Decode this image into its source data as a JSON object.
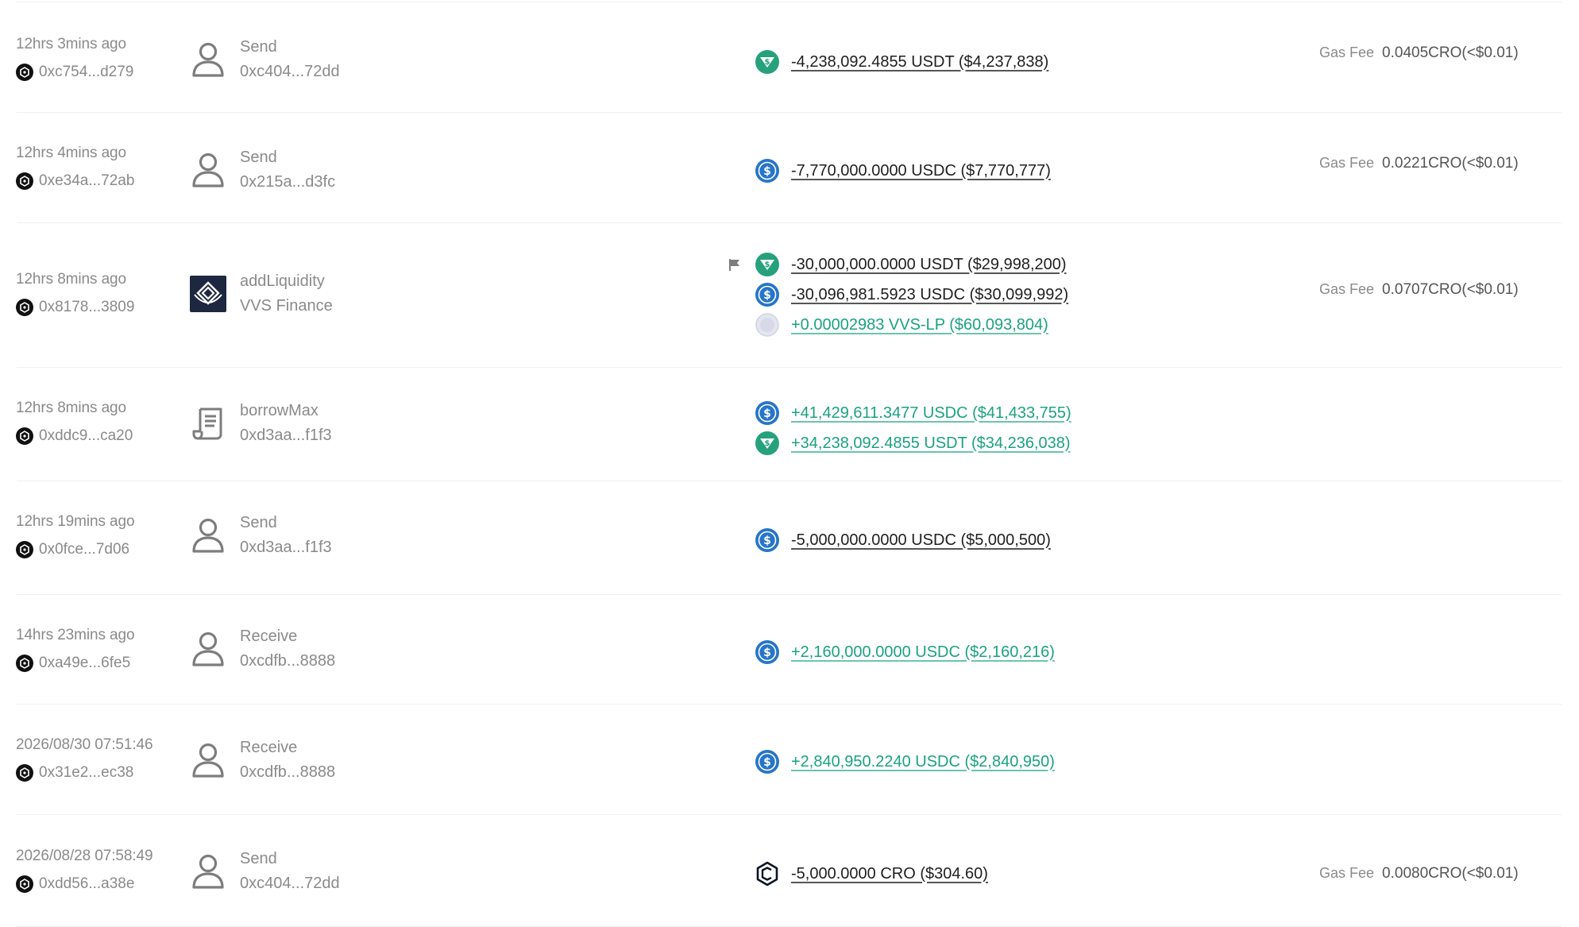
{
  "colors": {
    "positive": "#1aa283",
    "negative": "#1f1f1f",
    "muted": "#8a8a8a",
    "usdt": "#26a17b",
    "usdc": "#2775ca",
    "cro": "#0b1426"
  },
  "transactions": [
    {
      "time": "12hrs 3mins ago",
      "hash": "0xc754...d279",
      "action": "Send",
      "action_icon": "user-icon",
      "target": "0xc404...72dd",
      "flagged": false,
      "amounts": [
        {
          "text": "-4,238,092.4855 USDT ($4,237,838)",
          "token": "usdt",
          "sign": "neg"
        }
      ],
      "gas_label": "Gas Fee",
      "gas_value": "0.0405CRO(<$0.01)"
    },
    {
      "time": "12hrs 4mins ago",
      "hash": "0xe34a...72ab",
      "action": "Send",
      "action_icon": "user-icon",
      "target": "0x215a...d3fc",
      "flagged": false,
      "amounts": [
        {
          "text": "-7,770,000.0000 USDC ($7,770,777)",
          "token": "usdc",
          "sign": "neg"
        }
      ],
      "gas_label": "Gas Fee",
      "gas_value": "0.0221CRO(<$0.01)"
    },
    {
      "time": "12hrs 8mins ago",
      "hash": "0x8178...3809",
      "action": "addLiquidity",
      "action_icon": "vvs-finance-logo-icon",
      "target": "VVS Finance",
      "flagged": true,
      "amounts": [
        {
          "text": "-30,000,000.0000 USDT ($29,998,200)",
          "token": "usdt",
          "sign": "neg"
        },
        {
          "text": "-30,096,981.5923 USDC ($30,099,992)",
          "token": "usdc",
          "sign": "neg"
        },
        {
          "text": "+0.00002983 VVS-LP ($60,093,804)",
          "token": "lp",
          "sign": "pos"
        }
      ],
      "gas_label": "Gas Fee",
      "gas_value": "0.0707CRO(<$0.01)"
    },
    {
      "time": "12hrs 8mins ago",
      "hash": "0xddc9...ca20",
      "action": "borrowMax",
      "action_icon": "contract-scroll-icon",
      "target": "0xd3aa...f1f3",
      "flagged": false,
      "amounts": [
        {
          "text": "+41,429,611.3477 USDC ($41,433,755)",
          "token": "usdc",
          "sign": "pos"
        },
        {
          "text": "+34,238,092.4855 USDT ($34,236,038)",
          "token": "usdt",
          "sign": "pos"
        }
      ],
      "gas_label": "",
      "gas_value": ""
    },
    {
      "time": "12hrs 19mins ago",
      "hash": "0x0fce...7d06",
      "action": "Send",
      "action_icon": "user-icon",
      "target": "0xd3aa...f1f3",
      "flagged": false,
      "amounts": [
        {
          "text": "-5,000,000.0000 USDC ($5,000,500)",
          "token": "usdc",
          "sign": "neg"
        }
      ],
      "gas_label": "",
      "gas_value": ""
    },
    {
      "time": "14hrs 23mins ago",
      "hash": "0xa49e...6fe5",
      "action": "Receive",
      "action_icon": "user-icon",
      "target": "0xcdfb...8888",
      "flagged": false,
      "amounts": [
        {
          "text": "+2,160,000.0000 USDC ($2,160,216)",
          "token": "usdc",
          "sign": "pos"
        }
      ],
      "gas_label": "",
      "gas_value": ""
    },
    {
      "time": "2026/08/30 07:51:46",
      "hash": "0x31e2...ec38",
      "action": "Receive",
      "action_icon": "user-icon",
      "target": "0xcdfb...8888",
      "flagged": false,
      "amounts": [
        {
          "text": "+2,840,950.2240 USDC ($2,840,950)",
          "token": "usdc",
          "sign": "pos"
        }
      ],
      "gas_label": "",
      "gas_value": ""
    },
    {
      "time": "2026/08/28 07:58:49",
      "hash": "0xdd56...a38e",
      "action": "Send",
      "action_icon": "user-icon",
      "target": "0xc404...72dd",
      "flagged": false,
      "amounts": [
        {
          "text": "-5,000.0000 CRO ($304.60)",
          "token": "cro",
          "sign": "neg"
        }
      ],
      "gas_label": "Gas Fee",
      "gas_value": "0.0080CRO(<$0.01)"
    }
  ]
}
